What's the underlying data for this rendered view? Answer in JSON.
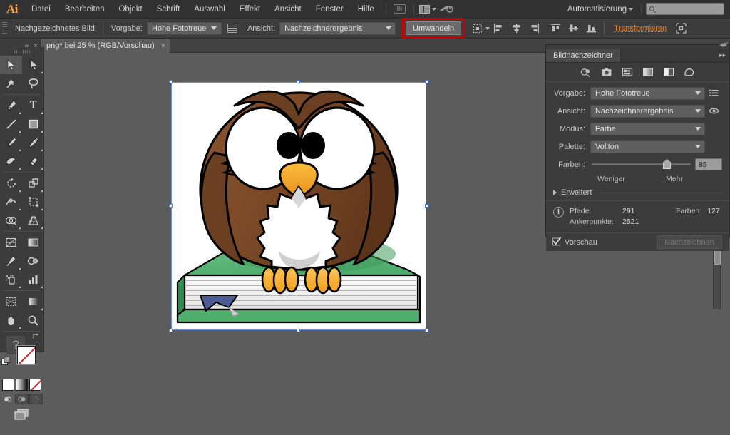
{
  "app": {
    "logo": "Ai",
    "title": "Adobe Illustrator"
  },
  "menubar": {
    "items": [
      {
        "label": "Datei"
      },
      {
        "label": "Bearbeiten"
      },
      {
        "label": "Objekt"
      },
      {
        "label": "Schrift"
      },
      {
        "label": "Auswahl"
      },
      {
        "label": "Effekt"
      },
      {
        "label": "Ansicht"
      },
      {
        "label": "Fenster"
      },
      {
        "label": "Hilfe"
      }
    ],
    "bridge_label": "Br",
    "arrange_icon": "arrange-documents-icon",
    "stock_icon": "stock-icon",
    "workspace": "Automatisierung",
    "search_placeholder": ""
  },
  "controlbar": {
    "object_label": "Nachgezeichnetes Bild",
    "preset_label": "Vorgabe:",
    "preset_value": "Hohe Fototreue",
    "panel_icon": "tracing-panel-icon",
    "view_label": "Ansicht:",
    "view_value": "Nachzeichnerergebnis",
    "expand_button": "Umwandeln",
    "align_to_label": "align-to-selection-icon",
    "align_icons": [
      "align-left-icon",
      "align-horizontal-center-icon",
      "align-right-icon",
      "align-top-icon",
      "align-vertical-center-icon",
      "align-bottom-icon"
    ],
    "transform_link": "Transformieren",
    "isolate_icon": "isolate-selected-icon"
  },
  "tabbar": {
    "doc_title": "png* bei 25 % (RGB/Vorschau)",
    "close_label": "×",
    "left_collapse": "«",
    "left_close": "×",
    "right_collapse": "«"
  },
  "tools": {
    "panel_name": "Werkzeuge",
    "items": [
      {
        "name": "selection-tool",
        "active": true
      },
      {
        "name": "direct-selection-tool",
        "active": false
      },
      {
        "name": "magic-wand-tool",
        "active": false
      },
      {
        "name": "lasso-tool",
        "active": false
      },
      {
        "name": "pen-tool",
        "active": false
      },
      {
        "name": "type-tool",
        "active": false
      },
      {
        "name": "line-segment-tool",
        "active": false
      },
      {
        "name": "rectangle-tool",
        "active": false
      },
      {
        "name": "paintbrush-tool",
        "active": false
      },
      {
        "name": "pencil-tool",
        "active": false
      },
      {
        "name": "blob-brush-tool",
        "active": false
      },
      {
        "name": "eraser-tool",
        "active": false
      },
      {
        "name": "rotate-tool",
        "active": false
      },
      {
        "name": "scale-tool",
        "active": false
      },
      {
        "name": "width-tool",
        "active": false
      },
      {
        "name": "free-transform-tool",
        "active": false
      },
      {
        "name": "shape-builder-tool",
        "active": false
      },
      {
        "name": "perspective-grid-tool",
        "active": false
      },
      {
        "name": "mesh-tool",
        "active": false
      },
      {
        "name": "gradient-tool",
        "active": false
      },
      {
        "name": "eyedropper-tool",
        "active": false
      },
      {
        "name": "blend-tool",
        "active": false
      },
      {
        "name": "symbol-sprayer-tool",
        "active": false
      },
      {
        "name": "column-graph-tool",
        "active": false
      },
      {
        "name": "artboard-tool",
        "active": false
      },
      {
        "name": "slice-tool",
        "active": false
      },
      {
        "name": "hand-tool",
        "active": false
      },
      {
        "name": "zoom-tool",
        "active": false
      }
    ],
    "fill_swatch": "fill-swatch",
    "stroke_swatch": "stroke-swatch",
    "swap_icon": "swap-fill-stroke-icon",
    "default_icon": "default-fill-stroke-icon",
    "help_glyph": "?",
    "color_modes": [
      "color-swatch",
      "gradient-swatch",
      "none-swatch"
    ],
    "draw_modes": [
      "draw-normal",
      "draw-behind",
      "draw-inside"
    ],
    "screen_mode": "change-screen-mode-icon"
  },
  "panel": {
    "tab_label": "Bildnachzeichner",
    "collapse_label": "▸▸",
    "mode_icons": [
      "auto-color-icon",
      "high-color-icon",
      "low-color-icon",
      "grayscale-icon",
      "black-white-icon",
      "outline-icon"
    ],
    "preset_label": "Vorgabe:",
    "preset_value": "Hohe Fototreue",
    "preset_menu_icon": "preset-menu-icon",
    "view_label": "Ansicht:",
    "view_value": "Nachzeichnerergebnis",
    "view_eye_icon": "eye-icon",
    "mode_label": "Modus:",
    "mode_value": "Farbe",
    "palette_label": "Palette:",
    "palette_value": "Vollton",
    "colors_label": "Farben:",
    "colors_value": "85",
    "slider_min_hint": "Weniger",
    "slider_max_hint": "Mehr",
    "slider_percent": 72,
    "advanced_label": "Erweitert",
    "info": {
      "paths_label": "Pfade:",
      "paths_value": "291",
      "colors_label": "Farben:",
      "colors_value": "127",
      "anchors_label": "Ankerpunkte:",
      "anchors_value": "2521"
    },
    "preview_label": "Vorschau",
    "preview_checked": true,
    "trace_button": "Nachzeichnen"
  },
  "artwork": {
    "name": "cartoon-owl-on-book-illustration",
    "zoom_level": "25 %",
    "colors": {
      "owl_body": "#7a4a28",
      "owl_body_light": "#8c5730",
      "owl_body_shadow": "#6b3f22",
      "beak": "#f5a623",
      "eye_white": "#ffffff",
      "pupil": "#000000",
      "belly": "#ffffff",
      "belly_shadow": "#d4d4d4",
      "book_cover": "#5bbd7e",
      "book_cover_dark": "#2e8b4f",
      "book_pages": "#f2f2f2",
      "bookmark": "#4a5c96",
      "outline": "#000000"
    }
  },
  "theme": {
    "chrome_bg": "#3c3c3c",
    "canvas_bg": "#5c5c5c",
    "accent_orange": "#f08020",
    "highlight_red": "#cc0000",
    "selection_blue": "#6f8fd8"
  }
}
